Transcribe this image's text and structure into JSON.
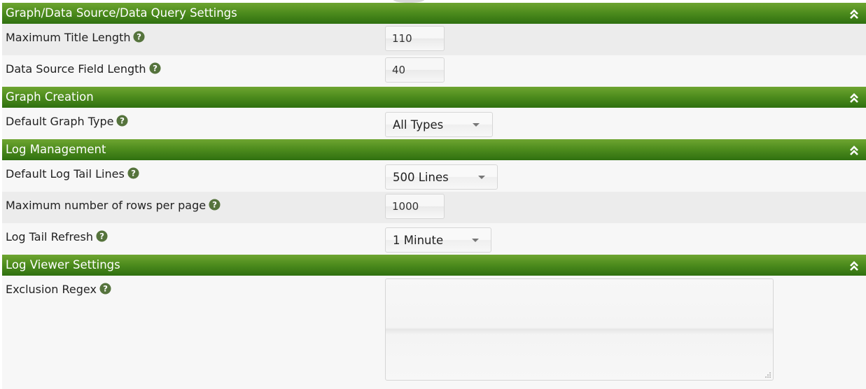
{
  "sections": {
    "graph_data": {
      "title": "Graph/Data Source/Data Query Settings",
      "max_title_length": {
        "label": "Maximum Title Length",
        "value": "110"
      },
      "ds_field_length": {
        "label": "Data Source Field Length",
        "value": "40"
      }
    },
    "graph_creation": {
      "title": "Graph Creation",
      "default_graph_type": {
        "label": "Default Graph Type",
        "selected": "All Types"
      }
    },
    "log_management": {
      "title": "Log Management",
      "default_log_tail_lines": {
        "label": "Default Log Tail Lines",
        "selected": "500 Lines"
      },
      "max_rows_per_page": {
        "label": "Maximum number of rows per page",
        "value": "1000"
      },
      "log_tail_refresh": {
        "label": "Log Tail Refresh",
        "selected": "1 Minute"
      }
    },
    "log_viewer": {
      "title": "Log Viewer Settings",
      "exclusion_regex": {
        "label": "Exclusion Regex",
        "value": ""
      }
    }
  },
  "icons": {
    "help": "question-circle-icon",
    "collapse": "double-chevron-up-icon",
    "dropdown": "caret-down-icon"
  },
  "colors": {
    "header_top": "#6ea531",
    "header_bottom": "#2f7010",
    "help_icon": "#55733c",
    "row_shade": "#ececec",
    "row_light": "#f7f7f7"
  }
}
